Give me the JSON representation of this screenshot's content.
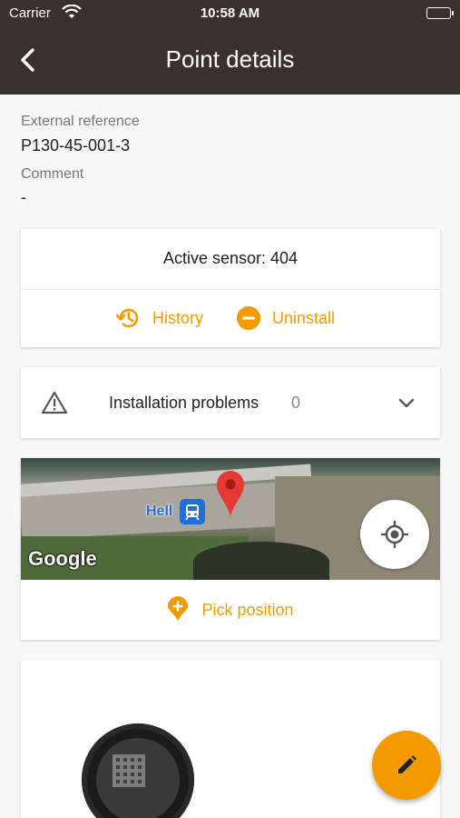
{
  "status_bar": {
    "carrier": "Carrier",
    "time": "10:58 AM"
  },
  "nav": {
    "title": "Point details",
    "back_icon": "chevron-left-icon"
  },
  "fields": {
    "external_reference_label": "External reference",
    "external_reference_value": "P130-45-001-3",
    "comment_label": "Comment",
    "comment_value": "-"
  },
  "sensor": {
    "active_label": "Active sensor: 404",
    "history_label": "History",
    "uninstall_label": "Uninstall"
  },
  "problems": {
    "label": "Installation problems",
    "count": "0"
  },
  "map": {
    "provider": "Google",
    "place_label": "Hell",
    "pick_label": "Pick position"
  },
  "colors": {
    "accent": "#f29a00",
    "header": "#3a302c",
    "pin": "#e53935"
  }
}
